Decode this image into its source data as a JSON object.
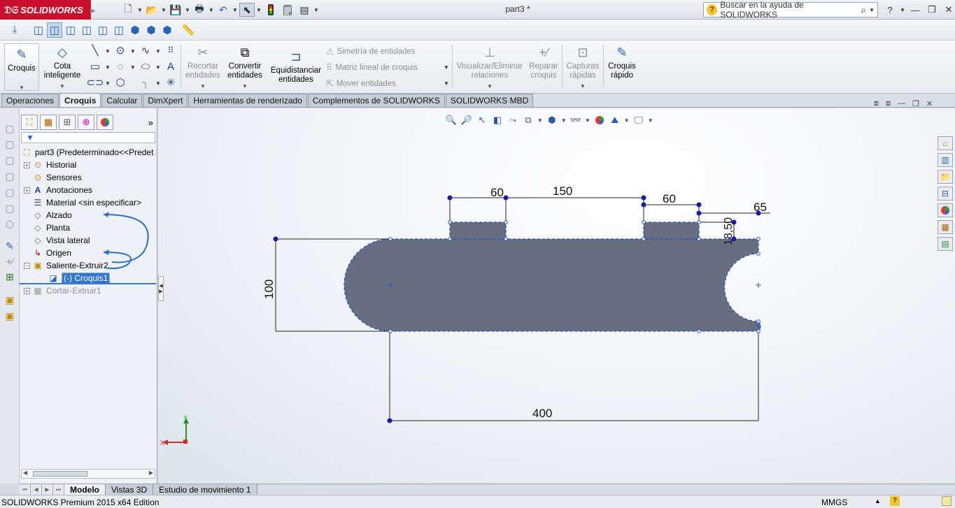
{
  "app": {
    "logo_text": "SOLIDWORKS",
    "document_title": "part3 *"
  },
  "help": {
    "placeholder": "Buscar en la ayuda de SOLIDWORKS"
  },
  "commands": {
    "croquis": "Croquis",
    "cota_inteligente_1": "Cota",
    "cota_inteligente_2": "inteligente",
    "recortar_1": "Recortar",
    "recortar_2": "entidades",
    "convertir_1": "Convertir",
    "convertir_2": "entidades",
    "equidistanciar_1": "Equidistanciar",
    "equidistanciar_2": "entidades",
    "simetria": "Simetría de entidades",
    "matriz_lineal": "Matriz lineal de croquis",
    "mover": "Mover entidades",
    "visualizar_1": "Visualizar/Eliminar",
    "visualizar_2": "relaciones",
    "reparar_1": "Reparar",
    "reparar_2": "croquis",
    "capturas_1": "Capturas",
    "capturas_2": "rápidas",
    "croquis_rapido_1": "Croquis",
    "croquis_rapido_2": "rápido"
  },
  "tabs": [
    "Operaciones",
    "Croquis",
    "Calcular",
    "DimXpert",
    "Herramientas de renderizado",
    "Complementos de SOLIDWORKS",
    "SOLIDWORKS MBD"
  ],
  "active_tab": "Croquis",
  "tree": {
    "root": "part3  (Predeterminado<<Predet",
    "nodes": [
      {
        "label": "Historial"
      },
      {
        "label": "Sensores"
      },
      {
        "label": "Anotaciones"
      },
      {
        "label": "Material <sin especificar>"
      },
      {
        "label": "Alzado"
      },
      {
        "label": "Planta"
      },
      {
        "label": "Vista lateral"
      },
      {
        "label": "Origen"
      },
      {
        "label": "Saliente-Extruir2"
      },
      {
        "label": "(-) Croquis1"
      },
      {
        "label": "Cortar-Extruir1"
      }
    ]
  },
  "dimensions": {
    "d1": "60",
    "d2": "150",
    "d3": "60",
    "d4": "65",
    "d5": "18,50",
    "d6": "100",
    "d7": "400"
  },
  "triad": {
    "x": "X",
    "y": "Y"
  },
  "bottom_tabs": [
    "Modelo",
    "Vistas 3D",
    "Estudio de movimiento 1"
  ],
  "status": {
    "edition": "SOLIDWORKS Premium 2015 x64 Edition",
    "units": "MMGS"
  },
  "colors": {
    "brand": "#c8102e",
    "sketch_fill": "#686e7f",
    "sketch_point": "#1a1aa8",
    "selection": "#3275d1"
  },
  "icons": [
    "new-document-icon",
    "open-icon",
    "save-icon",
    "print-icon",
    "undo-icon",
    "select-icon",
    "rebuild-icon",
    "options-icon",
    "search-icon",
    "help-icon"
  ]
}
